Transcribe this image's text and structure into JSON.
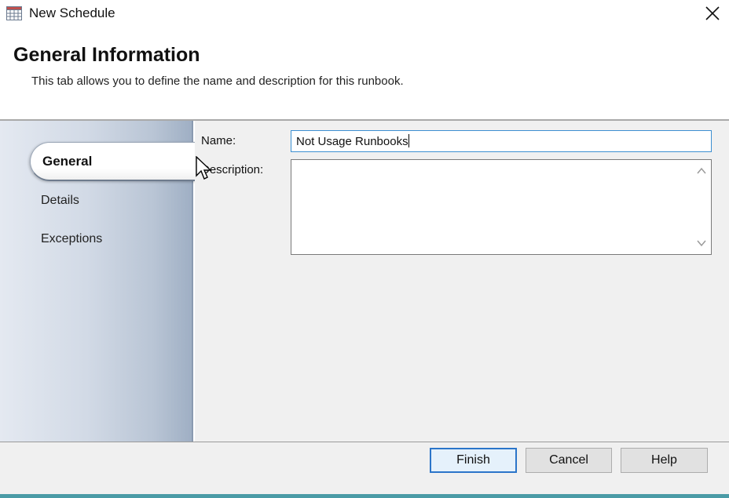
{
  "window": {
    "title": "New Schedule",
    "icon": "calendar-grid-icon",
    "close_icon": "close-icon"
  },
  "header": {
    "heading": "General Information",
    "subtitle": "This tab allows you to define the name and description for this runbook."
  },
  "sidebar": {
    "items": [
      {
        "label": "General",
        "active": true
      },
      {
        "label": "Details",
        "active": false
      },
      {
        "label": "Exceptions",
        "active": false
      }
    ]
  },
  "form": {
    "name_label": "Name:",
    "name_value": "Not Usage Runbooks",
    "description_label": "Description:",
    "description_value": ""
  },
  "footer": {
    "finish_label": "Finish",
    "cancel_label": "Cancel",
    "help_label": "Help"
  },
  "colors": {
    "accent": "#2b75c9",
    "input_focus": "#3c8fd1",
    "sidebar_gradient_end": "#9fafc4",
    "bottom_strip": "#4a9ba6"
  }
}
